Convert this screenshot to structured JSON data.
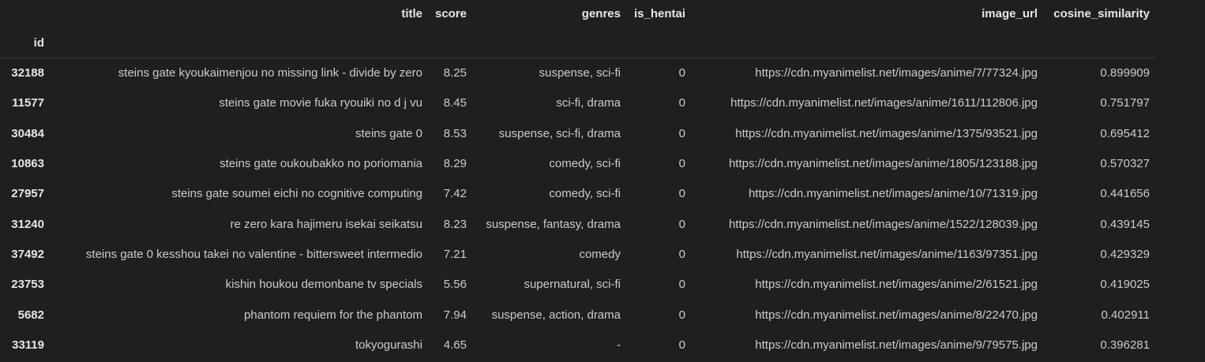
{
  "table": {
    "columns": [
      "title",
      "score",
      "genres",
      "is_hentai",
      "image_url",
      "cosine_similarity"
    ],
    "index_name": "id",
    "rows": [
      {
        "id": "32188",
        "title": "steins gate kyoukaimenjou no missing link - divide by zero",
        "score": "8.25",
        "genres": "suspense, sci-fi",
        "is_hentai": "0",
        "image_url": "https://cdn.myanimelist.net/images/anime/7/77324.jpg",
        "cosine_similarity": "0.899909"
      },
      {
        "id": "11577",
        "title": "steins gate movie fuka ryouiki no d j vu",
        "score": "8.45",
        "genres": "sci-fi, drama",
        "is_hentai": "0",
        "image_url": "https://cdn.myanimelist.net/images/anime/1611/112806.jpg",
        "cosine_similarity": "0.751797"
      },
      {
        "id": "30484",
        "title": "steins gate 0",
        "score": "8.53",
        "genres": "suspense, sci-fi, drama",
        "is_hentai": "0",
        "image_url": "https://cdn.myanimelist.net/images/anime/1375/93521.jpg",
        "cosine_similarity": "0.695412"
      },
      {
        "id": "10863",
        "title": "steins gate oukoubakko no poriomania",
        "score": "8.29",
        "genres": "comedy, sci-fi",
        "is_hentai": "0",
        "image_url": "https://cdn.myanimelist.net/images/anime/1805/123188.jpg",
        "cosine_similarity": "0.570327"
      },
      {
        "id": "27957",
        "title": "steins gate soumei eichi no cognitive computing",
        "score": "7.42",
        "genres": "comedy, sci-fi",
        "is_hentai": "0",
        "image_url": "https://cdn.myanimelist.net/images/anime/10/71319.jpg",
        "cosine_similarity": "0.441656"
      },
      {
        "id": "31240",
        "title": "re zero kara hajimeru isekai seikatsu",
        "score": "8.23",
        "genres": "suspense, fantasy, drama",
        "is_hentai": "0",
        "image_url": "https://cdn.myanimelist.net/images/anime/1522/128039.jpg",
        "cosine_similarity": "0.439145"
      },
      {
        "id": "37492",
        "title": "steins gate 0 kesshou takei no valentine - bittersweet intermedio",
        "score": "7.21",
        "genres": "comedy",
        "is_hentai": "0",
        "image_url": "https://cdn.myanimelist.net/images/anime/1163/97351.jpg",
        "cosine_similarity": "0.429329"
      },
      {
        "id": "23753",
        "title": "kishin houkou demonbane tv specials",
        "score": "5.56",
        "genres": "supernatural, sci-fi",
        "is_hentai": "0",
        "image_url": "https://cdn.myanimelist.net/images/anime/2/61521.jpg",
        "cosine_similarity": "0.419025"
      },
      {
        "id": "5682",
        "title": "phantom requiem for the phantom",
        "score": "7.94",
        "genres": "suspense, action, drama",
        "is_hentai": "0",
        "image_url": "https://cdn.myanimelist.net/images/anime/8/22470.jpg",
        "cosine_similarity": "0.402911"
      },
      {
        "id": "33119",
        "title": "tokyogurashi",
        "score": "4.65",
        "genres": "-",
        "is_hentai": "0",
        "image_url": "https://cdn.myanimelist.net/images/anime/9/79575.jpg",
        "cosine_similarity": "0.396281"
      }
    ]
  }
}
